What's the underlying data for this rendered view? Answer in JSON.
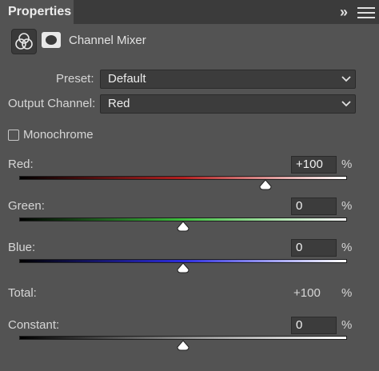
{
  "panel": {
    "tab_title": "Properties",
    "collapse_glyph": "»",
    "adjustment_title": "Channel Mixer"
  },
  "preset": {
    "label": "Preset:",
    "value": "Default"
  },
  "output_channel": {
    "label": "Output Channel:",
    "value": "Red"
  },
  "monochrome": {
    "label": "Monochrome",
    "checked": false
  },
  "sliders": [
    {
      "key": "red",
      "label": "Red:",
      "value": "+100",
      "unit": "%",
      "level": 0.75,
      "gradient": [
        "#000000",
        "#b52020",
        "#ffffff"
      ]
    },
    {
      "key": "green",
      "label": "Green:",
      "value": "0",
      "unit": "%",
      "level": 0.5,
      "gradient": [
        "#000000",
        "#3fbf3f",
        "#ffffff"
      ]
    },
    {
      "key": "blue",
      "label": "Blue:",
      "value": "0",
      "unit": "%",
      "level": 0.5,
      "gradient": [
        "#000000",
        "#2d2de0",
        "#ffffff"
      ]
    }
  ],
  "total": {
    "label": "Total:",
    "value": "+100",
    "unit": "%"
  },
  "constant": {
    "label": "Constant:",
    "value": "0",
    "unit": "%",
    "level": 0.5,
    "gradient": [
      "#000000",
      "#8a8a8a",
      "#ffffff"
    ]
  }
}
